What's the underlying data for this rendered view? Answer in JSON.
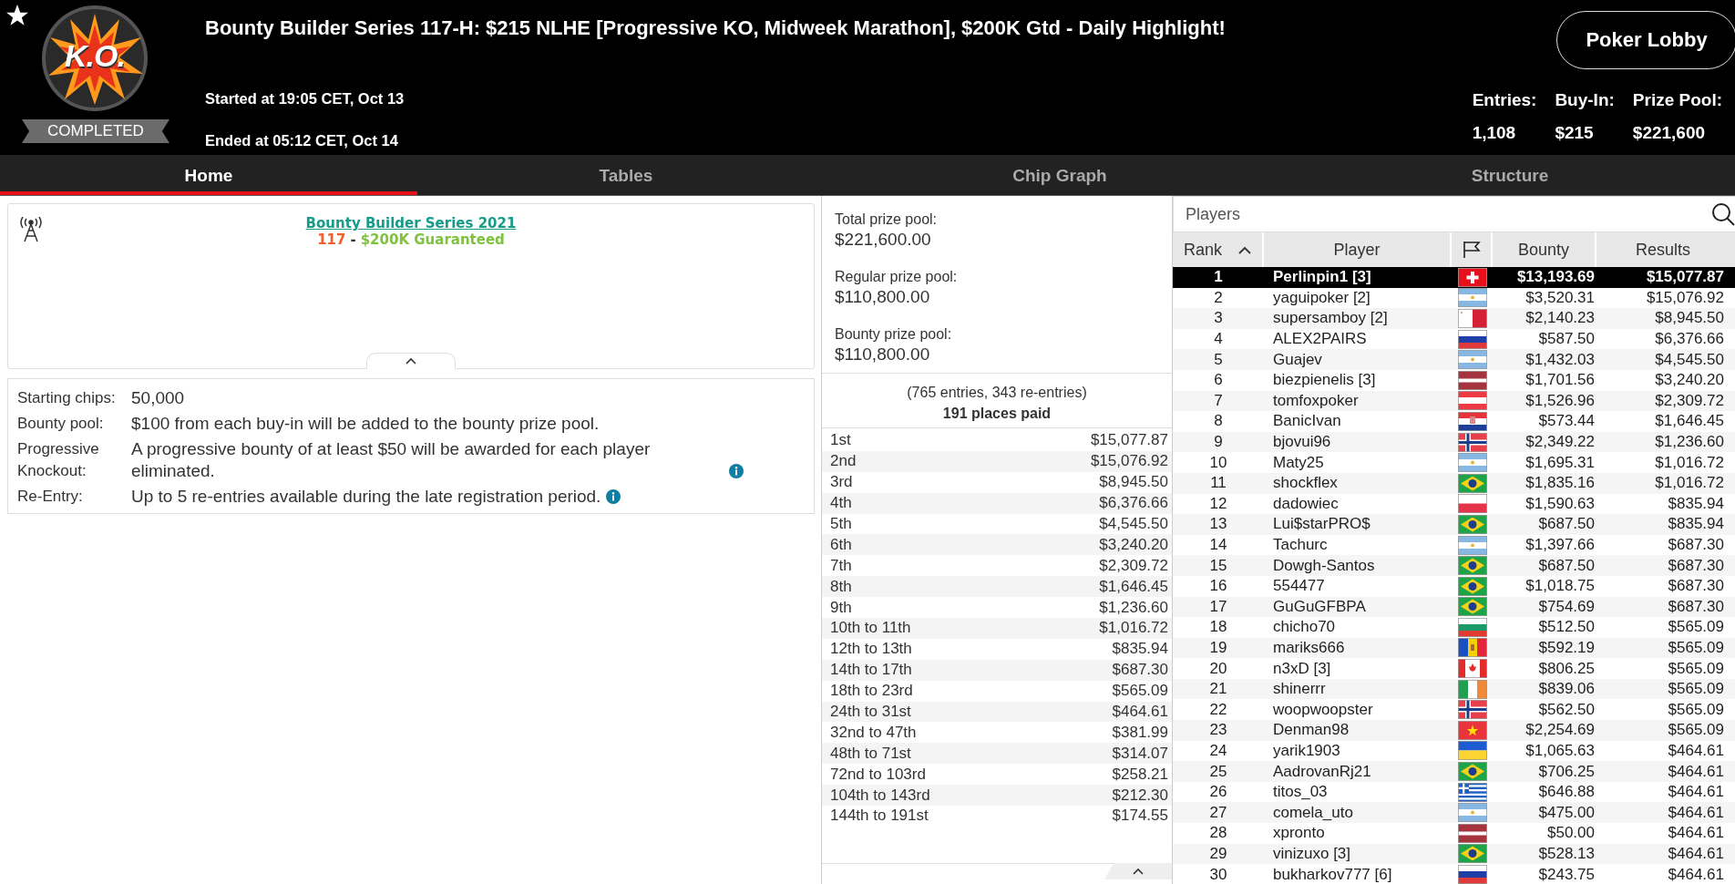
{
  "header": {
    "logo_text": "K.O.",
    "status": "COMPLETED",
    "title": "Bounty Builder Series 117-H: $215 NLHE [Progressive KO, Midweek Marathon], $200K Gtd - Daily Highlight!",
    "started": "Started at 19:05 CET, Oct 13",
    "ended": "Ended at 05:12 CET, Oct 14",
    "lobby_button": "Poker Lobby",
    "stats": [
      {
        "label": "Entries:",
        "value": "1,108"
      },
      {
        "label": "Buy-In:",
        "value": "$215"
      },
      {
        "label": "Prize Pool:",
        "value": "$221,600"
      }
    ]
  },
  "tabs": [
    {
      "label": "Home",
      "selected": true
    },
    {
      "label": "Tables",
      "selected": false
    },
    {
      "label": "Chip Graph",
      "selected": false
    },
    {
      "label": "Structure",
      "selected": false
    }
  ],
  "series_card": {
    "link": "Bounty Builder Series 2021",
    "number": "117",
    "separator": "-",
    "guarantee": "$200K Guaranteed"
  },
  "details": [
    {
      "label": "Starting chips:",
      "value": "50,000",
      "info": false
    },
    {
      "label": "Bounty pool:",
      "value": "$100 from each buy-in will be added to the bounty prize pool.",
      "info": false
    },
    {
      "label": "Progressive Knockout:",
      "value": "A progressive bounty of at least $50 will be awarded for each player eliminated.",
      "info": true
    },
    {
      "label": "Re-Entry:",
      "value": "Up to 5 re-entries available during the late registration period.",
      "info": true
    }
  ],
  "prize_pools": [
    {
      "label": "Total prize pool:",
      "value": "$221,600.00"
    },
    {
      "label": "Regular prize pool:",
      "value": "$110,800.00"
    },
    {
      "label": "Bounty prize pool:",
      "value": "$110,800.00"
    }
  ],
  "entries_note": "(765 entries, 343 re-entries)",
  "places_paid": "191 places paid",
  "payouts": [
    {
      "place": "1st",
      "amount": "$15,077.87"
    },
    {
      "place": "2nd",
      "amount": "$15,076.92"
    },
    {
      "place": "3rd",
      "amount": "$8,945.50"
    },
    {
      "place": "4th",
      "amount": "$6,376.66"
    },
    {
      "place": "5th",
      "amount": "$4,545.50"
    },
    {
      "place": "6th",
      "amount": "$3,240.20"
    },
    {
      "place": "7th",
      "amount": "$2,309.72"
    },
    {
      "place": "8th",
      "amount": "$1,646.45"
    },
    {
      "place": "9th",
      "amount": "$1,236.60"
    },
    {
      "place": "10th to 11th",
      "amount": "$1,016.72"
    },
    {
      "place": "12th to 13th",
      "amount": "$835.94"
    },
    {
      "place": "14th to 17th",
      "amount": "$687.30"
    },
    {
      "place": "18th to 23rd",
      "amount": "$565.09"
    },
    {
      "place": "24th to 31st",
      "amount": "$464.61"
    },
    {
      "place": "32nd to 47th",
      "amount": "$381.99"
    },
    {
      "place": "48th to 71st",
      "amount": "$314.07"
    },
    {
      "place": "72nd to 103rd",
      "amount": "$258.21"
    },
    {
      "place": "104th to 143rd",
      "amount": "$212.30"
    },
    {
      "place": "144th to 191st",
      "amount": "$174.55"
    }
  ],
  "players": {
    "title": "Players",
    "columns": [
      {
        "label": "Rank",
        "sorted": true
      },
      {
        "label": "Player",
        "sorted": false
      },
      {
        "label": "Bounty",
        "sorted": false
      },
      {
        "label": "Results",
        "sorted": false
      }
    ],
    "rows": [
      {
        "rank": "1",
        "player": "Perlinpin1 [3]",
        "kind": "switzerland",
        "bounty": "$13,193.69",
        "result": "$15,077.87",
        "selected": true
      },
      {
        "rank": "2",
        "player": "yaguipoker [2]",
        "kind": "argentina",
        "bounty": "$3,520.31",
        "result": "$15,076.92",
        "selected": false
      },
      {
        "rank": "3",
        "player": "supersamboy [2]",
        "kind": "malta",
        "bounty": "$2,140.23",
        "result": "$8,945.50",
        "selected": false
      },
      {
        "rank": "4",
        "player": "ALEX2PAIRS",
        "kind": "russia",
        "bounty": "$587.50",
        "result": "$6,376.66",
        "selected": false
      },
      {
        "rank": "5",
        "player": "Guajev",
        "kind": "argentina",
        "bounty": "$1,432.03",
        "result": "$4,545.50",
        "selected": false
      },
      {
        "rank": "6",
        "player": "biezpienelis [3]",
        "kind": "latvia",
        "bounty": "$1,701.56",
        "result": "$3,240.20",
        "selected": false
      },
      {
        "rank": "7",
        "player": "tomfoxpoker",
        "kind": "austria",
        "bounty": "$1,526.96",
        "result": "$2,309.72",
        "selected": false
      },
      {
        "rank": "8",
        "player": "BanicIvan",
        "kind": "croatia",
        "bounty": "$573.44",
        "result": "$1,646.45",
        "selected": false
      },
      {
        "rank": "9",
        "player": "bjovui96",
        "kind": "norway",
        "bounty": "$2,349.22",
        "result": "$1,236.60",
        "selected": false
      },
      {
        "rank": "10",
        "player": "Maty25",
        "kind": "argentina",
        "bounty": "$1,695.31",
        "result": "$1,016.72",
        "selected": false
      },
      {
        "rank": "11",
        "player": "shockflex",
        "kind": "brazil",
        "bounty": "$1,835.16",
        "result": "$1,016.72",
        "selected": false
      },
      {
        "rank": "12",
        "player": "dadowiec",
        "kind": "poland",
        "bounty": "$1,590.63",
        "result": "$835.94",
        "selected": false
      },
      {
        "rank": "13",
        "player": "Lui$starPRO$",
        "kind": "brazil",
        "bounty": "$687.50",
        "result": "$835.94",
        "selected": false
      },
      {
        "rank": "14",
        "player": "Tachurc",
        "kind": "argentina",
        "bounty": "$1,397.66",
        "result": "$687.30",
        "selected": false
      },
      {
        "rank": "15",
        "player": "Dowgh-Santos",
        "kind": "brazil",
        "bounty": "$687.50",
        "result": "$687.30",
        "selected": false
      },
      {
        "rank": "16",
        "player": "554477",
        "kind": "brazil",
        "bounty": "$1,018.75",
        "result": "$687.30",
        "selected": false
      },
      {
        "rank": "17",
        "player": "GuGuGFBPA",
        "kind": "brazil",
        "bounty": "$754.69",
        "result": "$687.30",
        "selected": false
      },
      {
        "rank": "18",
        "player": "chicho70",
        "kind": "bulgaria",
        "bounty": "$512.50",
        "result": "$565.09",
        "selected": false
      },
      {
        "rank": "19",
        "player": "mariks666",
        "kind": "moldova",
        "bounty": "$592.19",
        "result": "$565.09",
        "selected": false
      },
      {
        "rank": "20",
        "player": "n3xD [3]",
        "kind": "canada",
        "bounty": "$806.25",
        "result": "$565.09",
        "selected": false
      },
      {
        "rank": "21",
        "player": "shinerrr",
        "kind": "ireland",
        "bounty": "$839.06",
        "result": "$565.09",
        "selected": false
      },
      {
        "rank": "22",
        "player": "woopwoopster",
        "kind": "norway",
        "bounty": "$562.50",
        "result": "$565.09",
        "selected": false
      },
      {
        "rank": "23",
        "player": "Denman98",
        "kind": "vietnam",
        "bounty": "$2,254.69",
        "result": "$565.09",
        "selected": false
      },
      {
        "rank": "24",
        "player": "yarik1903",
        "kind": "ukraine",
        "bounty": "$1,065.63",
        "result": "$464.61",
        "selected": false
      },
      {
        "rank": "25",
        "player": "AadrovanRj21",
        "kind": "brazil",
        "bounty": "$706.25",
        "result": "$464.61",
        "selected": false
      },
      {
        "rank": "26",
        "player": "titos_03",
        "kind": "greece",
        "bounty": "$646.88",
        "result": "$464.61",
        "selected": false
      },
      {
        "rank": "27",
        "player": "comela_uto",
        "kind": "argentina",
        "bounty": "$475.00",
        "result": "$464.61",
        "selected": false
      },
      {
        "rank": "28",
        "player": "xpronto",
        "kind": "latvia",
        "bounty": "$50.00",
        "result": "$464.61",
        "selected": false
      },
      {
        "rank": "29",
        "player": "vinizuxo [3]",
        "kind": "brazil",
        "bounty": "$528.13",
        "result": "$464.61",
        "selected": false
      },
      {
        "rank": "30",
        "player": "bukharkov777 [6]",
        "kind": "russia",
        "bounty": "$243.75",
        "result": "$464.61",
        "selected": false
      }
    ]
  }
}
